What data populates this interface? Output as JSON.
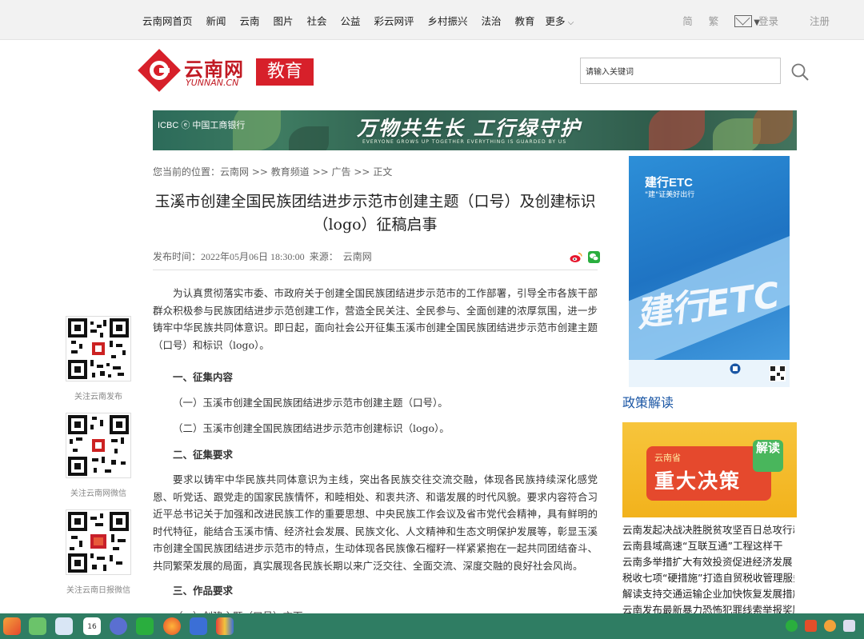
{
  "topnav": {
    "items": [
      "云南网首页",
      "新闻",
      "云南",
      "图片",
      "社会",
      "公益",
      "彩云网评",
      "乡村振兴",
      "法治",
      "教育"
    ],
    "more": "更多",
    "lang_simple": "简",
    "lang_trad": "繁",
    "login": "登录",
    "register": "注册"
  },
  "logo": {
    "name": "云南网",
    "domain": "YUNNAN.CN",
    "channel": "教育"
  },
  "search": {
    "value": "请输入关键词"
  },
  "banner": {
    "brand": "ICBC ⓔ 中国工商银行",
    "slogan": "万物共生长  工行绿守护",
    "subtitle": "EVERYONE GROWS UP TOGETHER    EVERYTHING IS GUARDED BY US"
  },
  "breadcrumb": {
    "prefix": "您当前的位置：",
    "items": [
      "云南网",
      "教育频道",
      "广告",
      "正文"
    ],
    "sep": " >> "
  },
  "article": {
    "title": "玉溪市创建全国民族团结进步示范市创建主题（口号）及创建标识（logo）征稿启事",
    "published_label": "发布时间：",
    "published": "2022年05月06日 18:30:00",
    "source_label": "来源：",
    "source": "云南网",
    "intro": "为认真贯彻落实市委、市政府关于创建全国民族团结进步示范市的工作部署，引导全市各族干部群众积极参与民族团结进步示范创建工作，营造全民关注、全民参与、全面创建的浓厚氛围，进一步铸牢中华民族共同体意识。即日起，面向社会公开征集玉溪市创建全国民族团结进步示范市创建主题（口号）和标识（logo）。",
    "sec1": "一、征集内容",
    "item1": "（一）玉溪市创建全国民族团结进步示范市创建主题（口号）。",
    "item2": "（二）玉溪市创建全国民族团结进步示范市创建标识（logo）。",
    "sec2": "二、征集要求",
    "req": "要求以铸牢中华民族共同体意识为主线，突出各民族交往交流交融，体现各民族持续深化感党恩、听党话、跟党走的国家民族情怀，和睦相处、和衷共济、和谐发展的时代风貌。要求内容符合习近平总书记关于加强和改进民族工作的重要思想、中央民族工作会议及省市党代会精神，具有鲜明的时代特征，能结合玉溪市情、经济社会发展、民族文化、人文精神和生态文明保护发展等，彰显玉溪市创建全国民族团结进步示范市的特点，生动体现各民族像石榴籽一样紧紧抱在一起共同团结奋斗、共同繁荣发展的局面，真实展现各民族长期以来广泛交往、全面交流、深度交融的良好社会风尚。",
    "sec3": "三、作品要求",
    "item3": "（一）创建主题（口号）方面："
  },
  "qr": {
    "labels": [
      "关注云南发布",
      "关注云南网微信",
      "关注云南日报微信"
    ]
  },
  "side_ad": {
    "title": "建行ETC",
    "tagline": "\"建\"证美好出行",
    "big": "建行ETC"
  },
  "policy": {
    "title": "政策解读",
    "ad_small": "云南省",
    "ad_big": "重大决策",
    "ad_badge": "解读"
  },
  "news": [
    "云南发起决战决胜脱贫攻坚百日总攻行动",
    "云南县域高速“互联互通”工程这样干",
    "云南多举措扩大有效投资促进经济发展",
    "税收七项“硬措施”打造自贸税收管理服务",
    "解读支持交通运输企业加快恢复发展措施",
    "云南发布最新暴力恐怖犯罪线索举报奖励"
  ],
  "colors": {
    "brand_red": "#d7202a",
    "link_blue": "#1a56a4",
    "taskbar": "#2f7d63"
  },
  "taskbar": {
    "icons": [
      "photos-icon",
      "music-icon",
      "files-icon",
      "calendar-icon",
      "settings-icon",
      "wechat-icon",
      "firefox-icon",
      "word-icon",
      "color-icon"
    ],
    "calendar_day": "16"
  }
}
